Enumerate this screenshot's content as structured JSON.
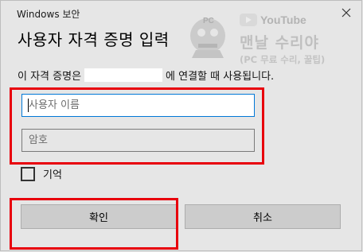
{
  "titlebar": {
    "title": "Windows 보안"
  },
  "heading": "사용자 자격 증명 입력",
  "description": {
    "before": "이 자격 증명은",
    "after": "에 연결할 때 사용됩니다."
  },
  "username": {
    "placeholder": "사용자 이름",
    "value": ""
  },
  "password": {
    "placeholder": "암호",
    "value": ""
  },
  "remember": {
    "label": "기억",
    "checked": false
  },
  "buttons": {
    "ok": "확인",
    "cancel": "취소"
  },
  "watermark": {
    "platform": "YouTube",
    "badge": "PC",
    "channel": "맨날 수리야",
    "tagline": "(PC 무료 수리, 꿀팁)"
  },
  "colors": {
    "highlight": "#e8000c",
    "focus": "#0078d7",
    "background": "#e6e6e6"
  }
}
